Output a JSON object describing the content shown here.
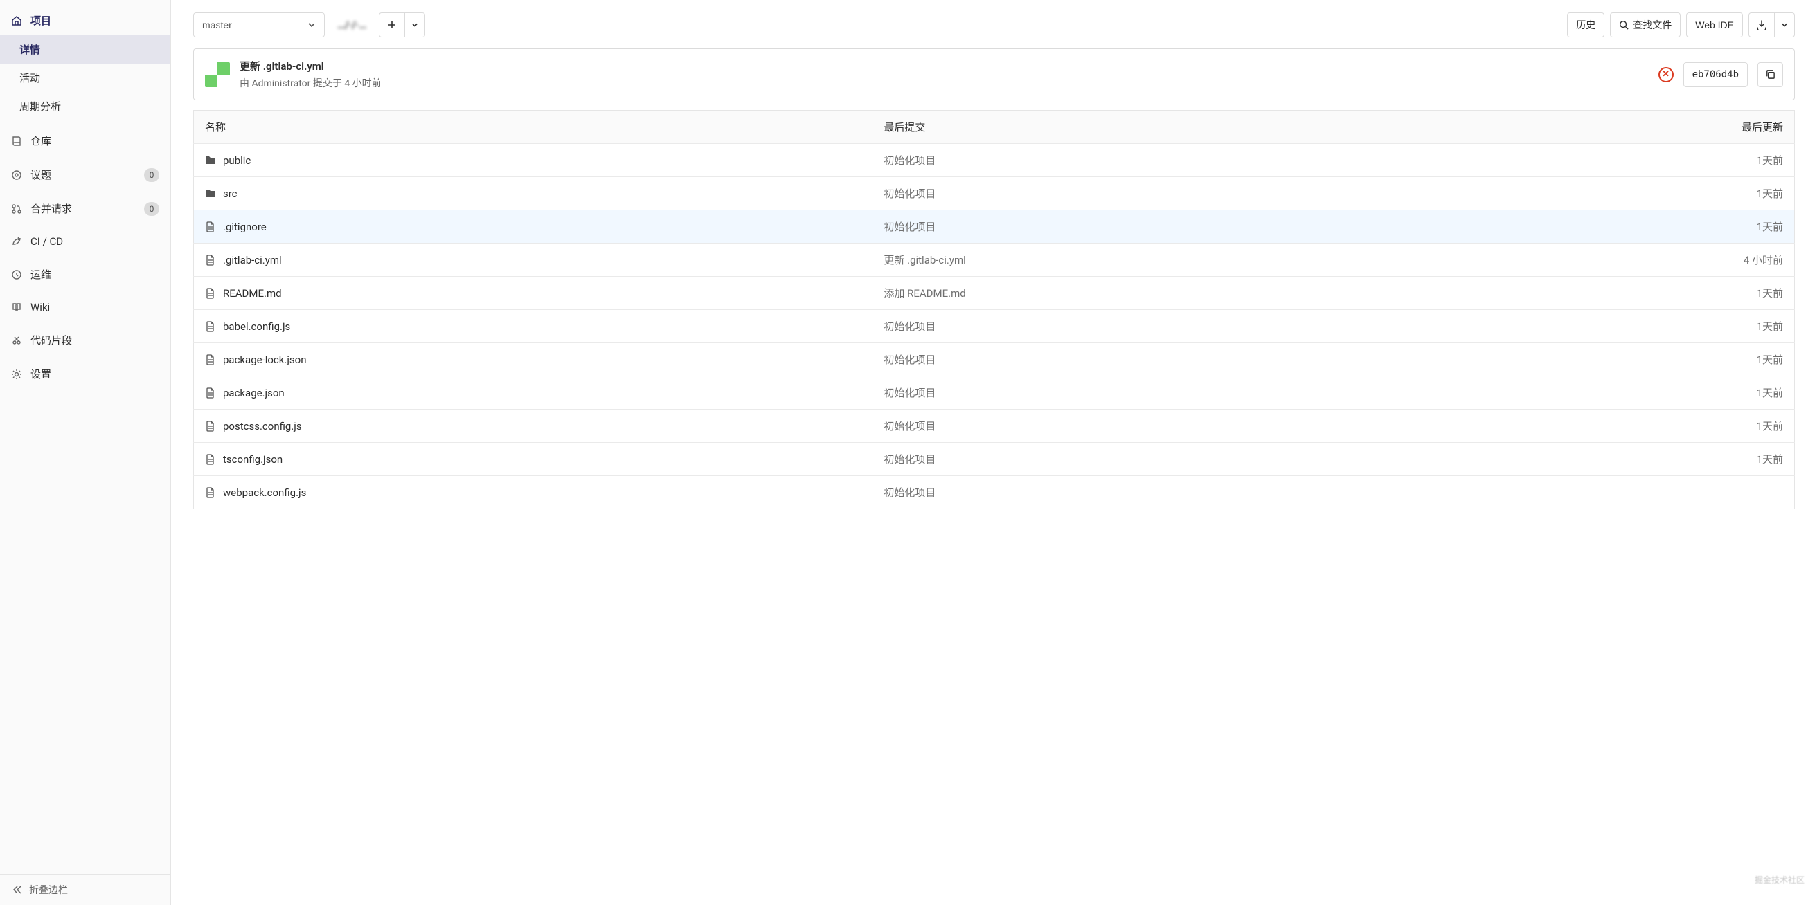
{
  "sidebar": {
    "project_label": "项目",
    "subitems": [
      "详情",
      "活动",
      "周期分析"
    ],
    "items": [
      {
        "icon": "repo",
        "label": "仓库",
        "badge": null
      },
      {
        "icon": "issues",
        "label": "议题",
        "badge": "0"
      },
      {
        "icon": "mr",
        "label": "合并请求",
        "badge": "0"
      },
      {
        "icon": "cicd",
        "label": "CI / CD",
        "badge": null
      },
      {
        "icon": "ops",
        "label": "运维",
        "badge": null
      },
      {
        "icon": "wiki",
        "label": "Wiki",
        "badge": null
      },
      {
        "icon": "snippets",
        "label": "代码片段",
        "badge": null
      },
      {
        "icon": "settings",
        "label": "设置",
        "badge": null
      }
    ],
    "collapse_label": "折叠边栏"
  },
  "toolbar": {
    "branch": "master",
    "breadcrumb": "…/·/·…",
    "history": "历史",
    "find_file": "查找文件",
    "web_ide": "Web IDE"
  },
  "commit": {
    "title": "更新 .gitlab-ci.yml",
    "subtitle": "由 Administrator 提交于 4 小时前",
    "sha": "eb706d4b"
  },
  "table": {
    "headers": {
      "name": "名称",
      "last_commit": "最后提交",
      "last_update": "最后更新"
    },
    "rows": [
      {
        "type": "folder",
        "name": "public",
        "commit": "初始化项目",
        "time": "1天前"
      },
      {
        "type": "folder",
        "name": "src",
        "commit": "初始化项目",
        "time": "1天前"
      },
      {
        "type": "file",
        "name": ".gitignore",
        "commit": "初始化项目",
        "time": "1天前",
        "hl": true
      },
      {
        "type": "file",
        "name": ".gitlab-ci.yml",
        "commit": "更新 .gitlab-ci.yml",
        "time": "4 小时前"
      },
      {
        "type": "file",
        "name": "README.md",
        "commit": "添加 README.md",
        "time": "1天前"
      },
      {
        "type": "file",
        "name": "babel.config.js",
        "commit": "初始化项目",
        "time": "1天前"
      },
      {
        "type": "file",
        "name": "package-lock.json",
        "commit": "初始化项目",
        "time": "1天前"
      },
      {
        "type": "file",
        "name": "package.json",
        "commit": "初始化项目",
        "time": "1天前"
      },
      {
        "type": "file",
        "name": "postcss.config.js",
        "commit": "初始化项目",
        "time": "1天前"
      },
      {
        "type": "file",
        "name": "tsconfig.json",
        "commit": "初始化项目",
        "time": "1天前"
      },
      {
        "type": "file",
        "name": "webpack.config.js",
        "commit": "初始化项目",
        "time": ""
      }
    ]
  },
  "watermark": "掘金技术社区"
}
